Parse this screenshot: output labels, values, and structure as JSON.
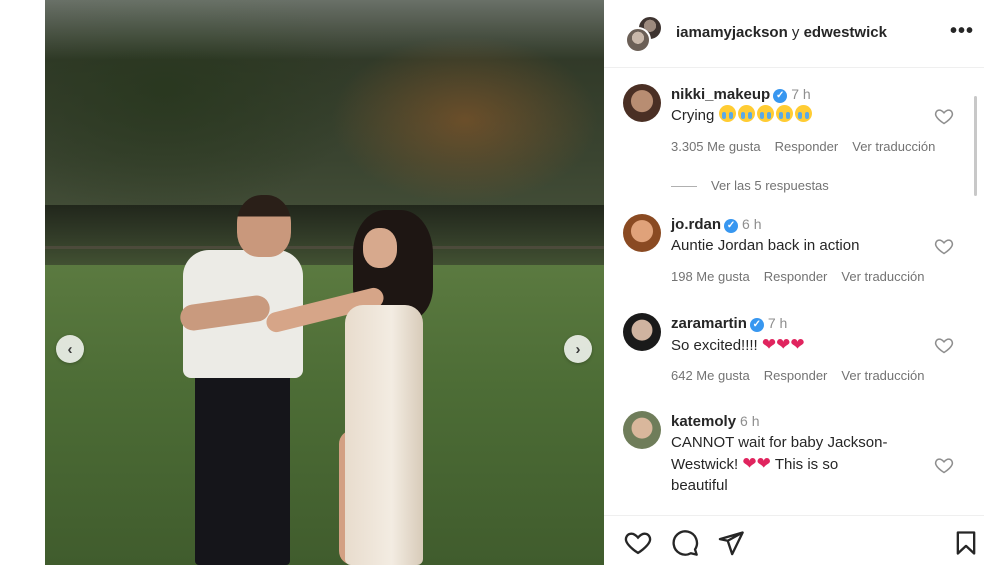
{
  "header": {
    "user1": "iamamyjackson",
    "conj": "y",
    "user2": "edwestwick"
  },
  "comments": [
    {
      "username": "nikki_makeup",
      "verified": true,
      "time": "7 h",
      "text": "Crying",
      "emoji": "loudly-crying-face x5",
      "likes": "3.305 Me gusta",
      "reply": "Responder",
      "translate": "Ver traducción",
      "replies_label": "Ver las 5 respuestas"
    },
    {
      "username": "jo.rdan",
      "verified": true,
      "time": "6 h",
      "text": "Auntie Jordan back in action",
      "likes": "198 Me gusta",
      "reply": "Responder",
      "translate": "Ver traducción"
    },
    {
      "username": "zaramartin",
      "verified": true,
      "time": "7 h",
      "text": "So excited!!!!",
      "emoji": "red-heart x3",
      "likes": "642 Me gusta",
      "reply": "Responder",
      "translate": "Ver traducción"
    },
    {
      "username": "katemoly",
      "verified": false,
      "time": "6 h",
      "text_a": "CANNOT wait for baby Jackson-",
      "text_b": "Westwick!",
      "text_c": "This is so",
      "text_d": "beautiful",
      "emoji": "red-heart x2"
    }
  ],
  "icons": {
    "more": "more-horizontal-icon",
    "prev": "chevron-left-icon",
    "next": "chevron-right-icon",
    "like": "heart-outline-icon",
    "comment": "comment-bubble-icon",
    "share": "paper-plane-icon",
    "save": "bookmark-icon"
  },
  "colors": {
    "verified": "#3897f0",
    "meta_text": "#737373",
    "heart_emoji": "#e0245e"
  }
}
